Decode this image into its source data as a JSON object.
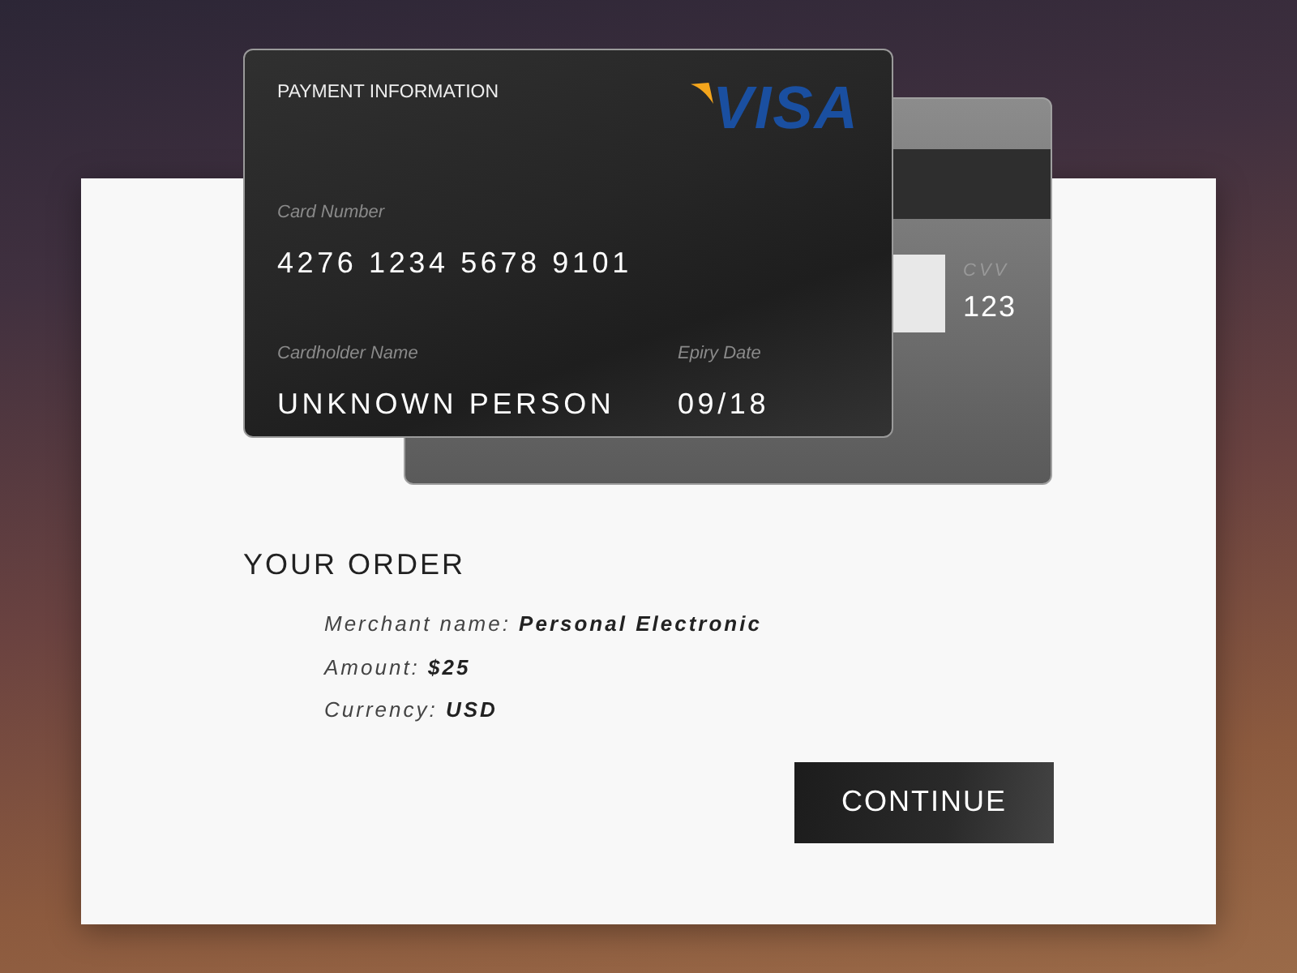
{
  "card_front": {
    "title": "PAYMENT INFORMATION",
    "brand": "VISA",
    "fields": [
      {
        "label": "Card Number",
        "value": "4276 1234 5678 9101"
      },
      {
        "label": "Cardholder Name",
        "value": "UNKNOWN PERSON"
      },
      {
        "label": "Epiry Date",
        "value": "09/18"
      }
    ]
  },
  "card_back": {
    "cvv_label": "CVV",
    "cvv": "123"
  },
  "order": {
    "title": "YOUR ORDER",
    "items": [
      "Merchant name: **Personal Electronic**",
      "Amount: **$25**",
      "Currency: **USD**"
    ]
  },
  "button": "CONTINUE"
}
